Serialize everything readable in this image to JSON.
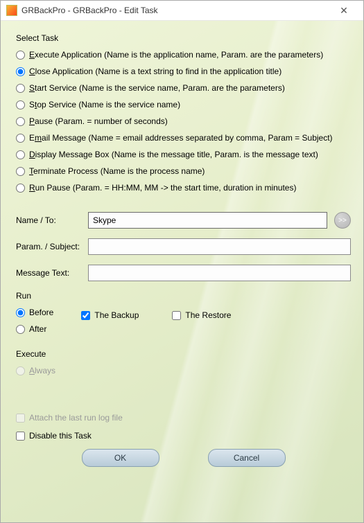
{
  "window": {
    "title": "GRBackPro - GRBackPro - Edit Task"
  },
  "select_task": {
    "label": "Select Task",
    "options": {
      "execute_app": "Execute Application (Name is the application name, Param. are the parameters)",
      "close_app": "Close Application (Name is a text string to find in the application title)",
      "start_service": "Start Service  (Name is the service name, Param. are the parameters)",
      "stop_service": "Stop Service  (Name is the service name)",
      "pause": "Pause   (Param. = number of seconds)",
      "email_msg": "Email Message (Name = email addresses separated by comma, Param =  Subject)",
      "display_msg": "Display Message Box (Name is the message title, Param. is the message text)",
      "terminate": "Terminate Process (Name is the process name)",
      "run_pause": "Run Pause (Param. = HH:MM, MM -> the start time, duration in minutes)"
    },
    "selected": "close_app"
  },
  "fields": {
    "name_label": "Name / To:",
    "name_value": "Skype",
    "param_label": "Param. / Subject:",
    "param_value": "",
    "message_label": "Message Text:",
    "message_value": "",
    "go_glyph": ">>"
  },
  "run": {
    "label": "Run",
    "before": "Before",
    "after": "After",
    "selected": "before",
    "the_backup": "The Backup",
    "the_backup_checked": true,
    "the_restore": "The Restore",
    "the_restore_checked": false
  },
  "execute": {
    "label": "Execute",
    "always": "Always"
  },
  "bottom": {
    "attach_log": "Attach the last run log file",
    "attach_log_checked": false,
    "attach_log_enabled": false,
    "disable_task": "Disable this Task",
    "disable_task_checked": false
  },
  "buttons": {
    "ok": "OK",
    "cancel": "Cancel"
  }
}
